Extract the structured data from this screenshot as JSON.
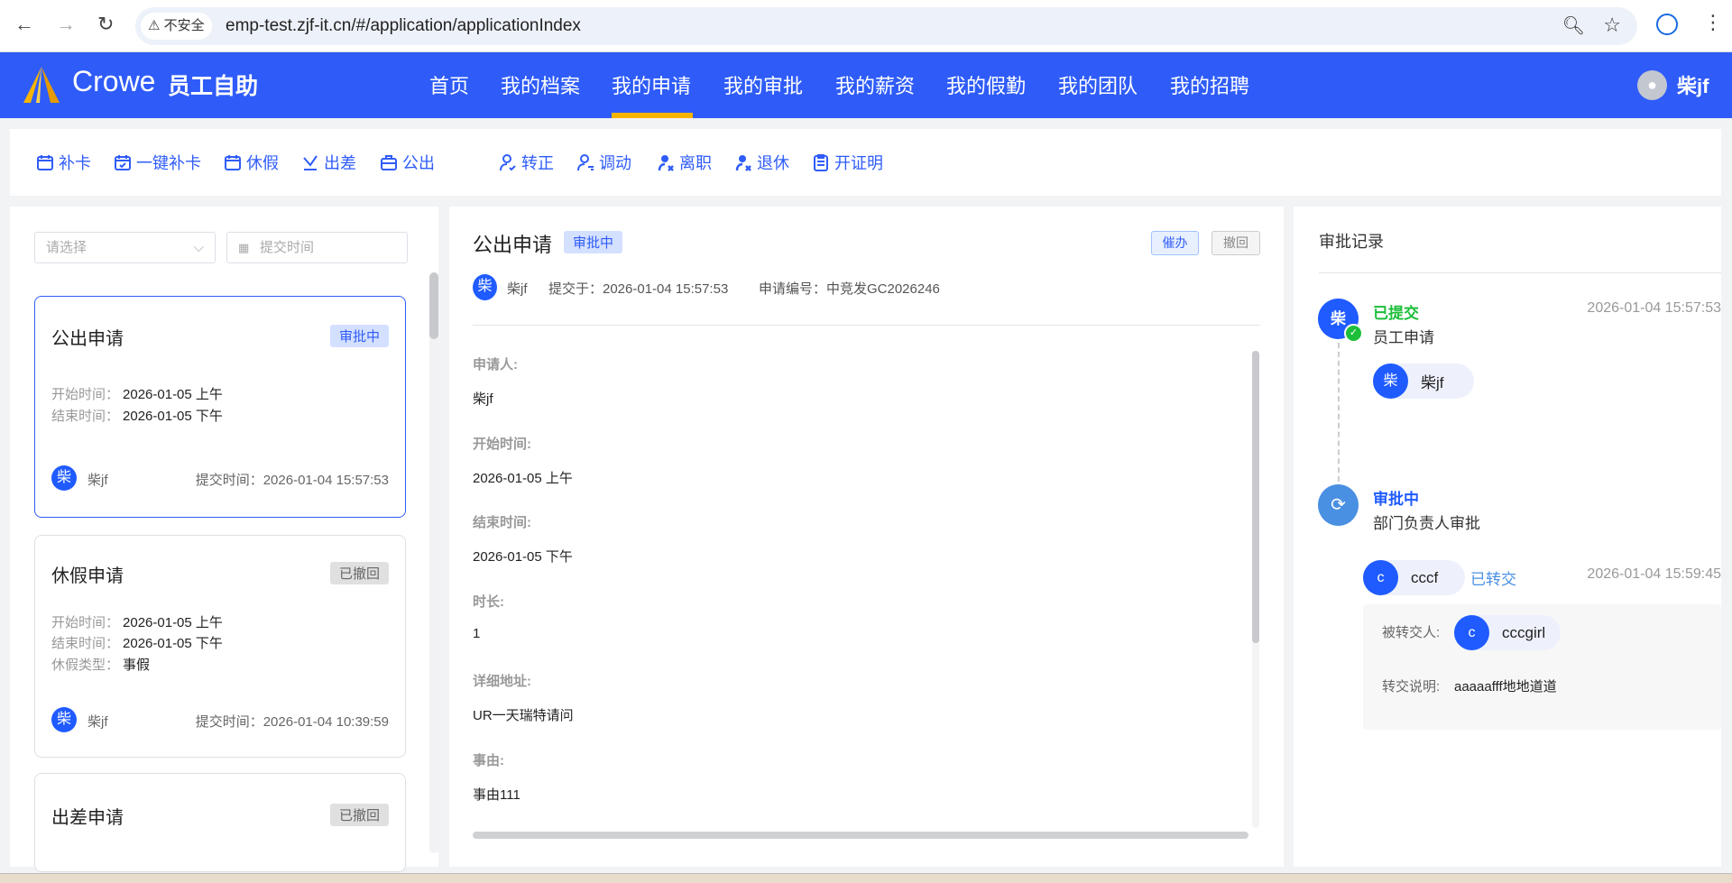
{
  "browser": {
    "security": "不安全",
    "url": "emp-test.zjf-it.cn/#/application/applicationIndex"
  },
  "header": {
    "logo": "Crowe",
    "app_name": "员工自助",
    "nav": [
      "首页",
      "我的档案",
      "我的申请",
      "我的审批",
      "我的薪资",
      "我的假勤",
      "我的团队",
      "我的招聘"
    ],
    "active": "我的申请",
    "user": "柴jf"
  },
  "toolbar": {
    "items": [
      "补卡",
      "一键补卡",
      "休假",
      "出差",
      "公出",
      "转正",
      "调动",
      "离职",
      "退休",
      "开证明"
    ]
  },
  "list": {
    "select_placeholder": "请选择",
    "date_placeholder": "提交时间",
    "cards": [
      {
        "title": "公出申请",
        "status": "审批中",
        "rows": [
          [
            "开始时间：",
            "2026-01-05 上午"
          ],
          [
            "结束时间：",
            "2026-01-05 下午"
          ]
        ],
        "avatar": "柴",
        "user": "柴jf",
        "submit": "提交时间：2026-01-04 15:57:53"
      },
      {
        "title": "休假申请",
        "status": "已撤回",
        "rows": [
          [
            "开始时间：",
            "2026-01-05 上午"
          ],
          [
            "结束时间：",
            "2026-01-05 下午"
          ],
          [
            "休假类型：",
            "事假"
          ]
        ],
        "avatar": "柴",
        "user": "柴jf",
        "submit": "提交时间：2026-01-04 10:39:59"
      },
      {
        "title": "出差申请",
        "status": "已撤回"
      }
    ]
  },
  "detail": {
    "title": "公出申请",
    "status": "审批中",
    "urge": "催办",
    "withdraw": "撤回",
    "avatar": "柴",
    "user": "柴jf",
    "submitted": "提交于：2026-01-04 15:57:53",
    "number": "申请编号：中竞发GC2026246",
    "fields": [
      [
        "申请人:",
        "柴jf"
      ],
      [
        "开始时间:",
        "2026-01-05 上午"
      ],
      [
        "结束时间:",
        "2026-01-05 下午"
      ],
      [
        "时长:",
        "1"
      ],
      [
        "详细地址:",
        "UR一天瑞特请问"
      ],
      [
        "事由:",
        "事由111"
      ]
    ]
  },
  "records": {
    "title": "审批记录",
    "n1": {
      "avatar": "柴",
      "status": "已提交",
      "step": "员工申请",
      "time": "2026-01-04 15:57:53",
      "chip_avatar": "柴",
      "chip_name": "柴jf"
    },
    "n2": {
      "status": "审批中",
      "step": "部门负责人审批",
      "chip_avatar": "c",
      "chip_name": "cccf",
      "action": "已转交",
      "time": "2026-01-04 15:59:45",
      "to_label": "被转交人:",
      "to_avatar": "c",
      "to_name": "cccgirl",
      "note_label": "转交说明:",
      "note": "aaaaafff地地道道"
    }
  },
  "colors": {
    "brand": "#2F5CF8",
    "accent": "#F7B500",
    "success": "#1DBF3A"
  }
}
